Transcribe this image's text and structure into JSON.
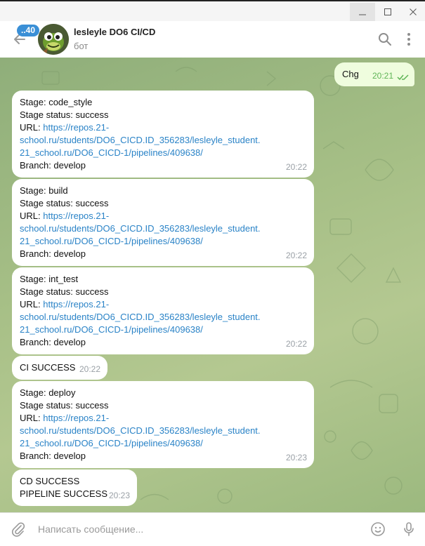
{
  "window": {
    "buttons": [
      "minimize",
      "maximize",
      "close"
    ]
  },
  "header": {
    "unread_count": "..40",
    "chat_name": "lesleyle DO6 CI/CD",
    "chat_subtitle": "бот",
    "icons": [
      "back-arrow-icon",
      "search-icon",
      "more-vertical-icon"
    ]
  },
  "messages": [
    {
      "direction": "out",
      "text": "Chg",
      "time": "20:21",
      "status": "read"
    },
    {
      "direction": "in",
      "stage": "Stage: code_style",
      "status": "Stage status: success",
      "url_label": "URL: ",
      "url_1": "https://repos.21-",
      "url_2": "school.ru/students/DO6_CICD.ID_356283/lesleyle_student.",
      "url_3": "21_school.ru/DO6_CICD-1/pipelines/409638/",
      "branch": "Branch: develop",
      "time": "20:22"
    },
    {
      "direction": "in",
      "stage": "Stage: build",
      "status": "Stage status: success",
      "url_label": "URL: ",
      "url_1": "https://repos.21-",
      "url_2": "school.ru/students/DO6_CICD.ID_356283/lesleyle_student.",
      "url_3": "21_school.ru/DO6_CICD-1/pipelines/409638/",
      "branch": "Branch: develop",
      "time": "20:22"
    },
    {
      "direction": "in",
      "stage": "Stage: int_test",
      "status": "Stage status: success",
      "url_label": "URL: ",
      "url_1": "https://repos.21-",
      "url_2": "school.ru/students/DO6_CICD.ID_356283/lesleyle_student.",
      "url_3": "21_school.ru/DO6_CICD-1/pipelines/409638/",
      "branch": "Branch: develop",
      "time": "20:22"
    },
    {
      "direction": "in",
      "line1": "CI SUCCESS",
      "time": "20:22"
    },
    {
      "direction": "in",
      "stage": "Stage: deploy",
      "status": "Stage status: success",
      "url_label": "URL: ",
      "url_1": "https://repos.21-",
      "url_2": "school.ru/students/DO6_CICD.ID_356283/lesleyle_student.",
      "url_3": "21_school.ru/DO6_CICD-1/pipelines/409638/",
      "branch": "Branch: develop",
      "time": "20:23"
    },
    {
      "direction": "in",
      "line1": "CD SUCCESS",
      "line2": "PIPELINE SUCCESS",
      "time": "20:23"
    }
  ],
  "composer": {
    "placeholder": "Написать сообщение...",
    "icons": [
      "attach-icon",
      "emoji-icon",
      "microphone-icon"
    ]
  },
  "colors": {
    "accent": "#3a8fd6",
    "link": "#2a83c7",
    "outgoing_bubble": "#effdde",
    "outgoing_time": "#5fb556",
    "chat_background": "#a6bf86"
  }
}
